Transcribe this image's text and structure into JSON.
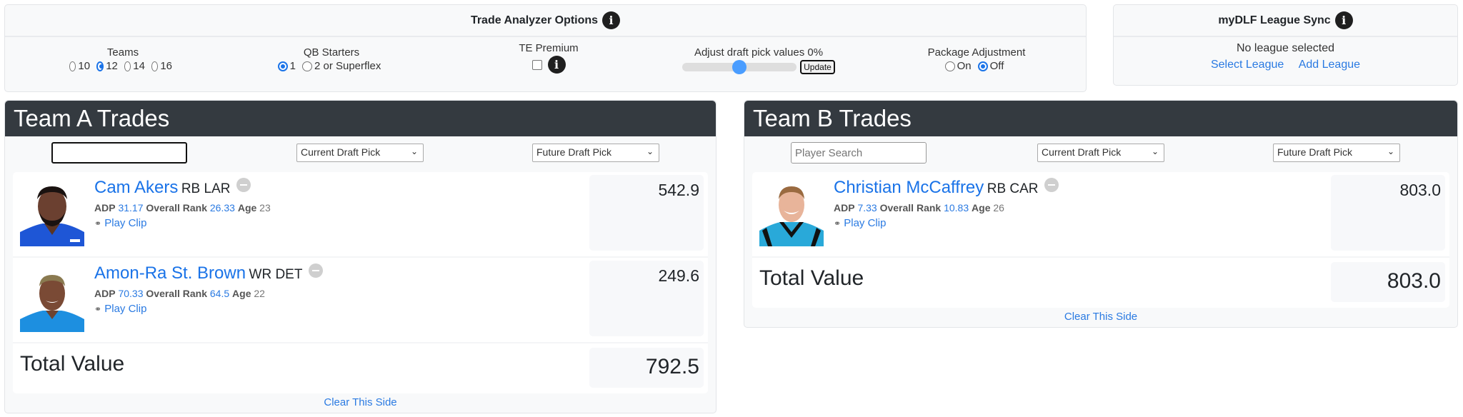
{
  "options": {
    "title": "Trade Analyzer Options",
    "teams": {
      "label": "Teams",
      "choices": [
        "10",
        "12",
        "14",
        "16"
      ],
      "selected": "12"
    },
    "qb_starters": {
      "label": "QB Starters",
      "choices": [
        "1",
        "2 or Superflex"
      ],
      "selected": "1"
    },
    "te_premium": {
      "label": "TE Premium",
      "checked": false
    },
    "draft_pick": {
      "label": "Adjust draft pick values 0%",
      "slider_fraction": 0.5,
      "update_label": "Update"
    },
    "package_adjustment": {
      "label": "Package Adjustment",
      "choices": [
        "On",
        "Off"
      ],
      "selected": "Off"
    }
  },
  "sync": {
    "title": "myDLF League Sync",
    "status": "No league selected",
    "select_label": "Select League",
    "add_label": "Add League"
  },
  "teamA": {
    "title": "Team A Trades",
    "search_value": "",
    "search_placeholder": "",
    "current_pick": "Current Draft Pick",
    "future_pick": "Future Draft Pick",
    "players": [
      {
        "name": "Cam Akers",
        "pos_team": "RB LAR",
        "adp_label": "ADP",
        "adp": "31.17",
        "rank_label": "Overall Rank",
        "rank": "26.33",
        "age_label": "Age",
        "age": "23",
        "clip_label": "Play Clip",
        "value": "542.9",
        "jersey": "#1e56d6"
      },
      {
        "name": "Amon-Ra St. Brown",
        "pos_team": "WR DET",
        "adp_label": "ADP",
        "adp": "70.33",
        "rank_label": "Overall Rank",
        "rank": "64.5",
        "age_label": "Age",
        "age": "22",
        "clip_label": "Play Clip",
        "value": "249.6",
        "jersey": "#1d8fe0"
      }
    ],
    "total_label": "Total Value",
    "total": "792.5",
    "clear_label": "Clear This Side"
  },
  "teamB": {
    "title": "Team B Trades",
    "search_value": "",
    "search_placeholder": "Player Search",
    "current_pick": "Current Draft Pick",
    "future_pick": "Future Draft Pick",
    "players": [
      {
        "name": "Christian McCaffrey",
        "pos_team": "RB CAR",
        "adp_label": "ADP",
        "adp": "7.33",
        "rank_label": "Overall Rank",
        "rank": "10.83",
        "age_label": "Age",
        "age": "26",
        "clip_label": "Play Clip",
        "value": "803.0",
        "jersey": "#29a9d9"
      }
    ],
    "total_label": "Total Value",
    "total": "803.0",
    "clear_label": "Clear This Side"
  },
  "icons": {
    "info": "i",
    "headphones": "🎧",
    "chevron": "⌄"
  }
}
